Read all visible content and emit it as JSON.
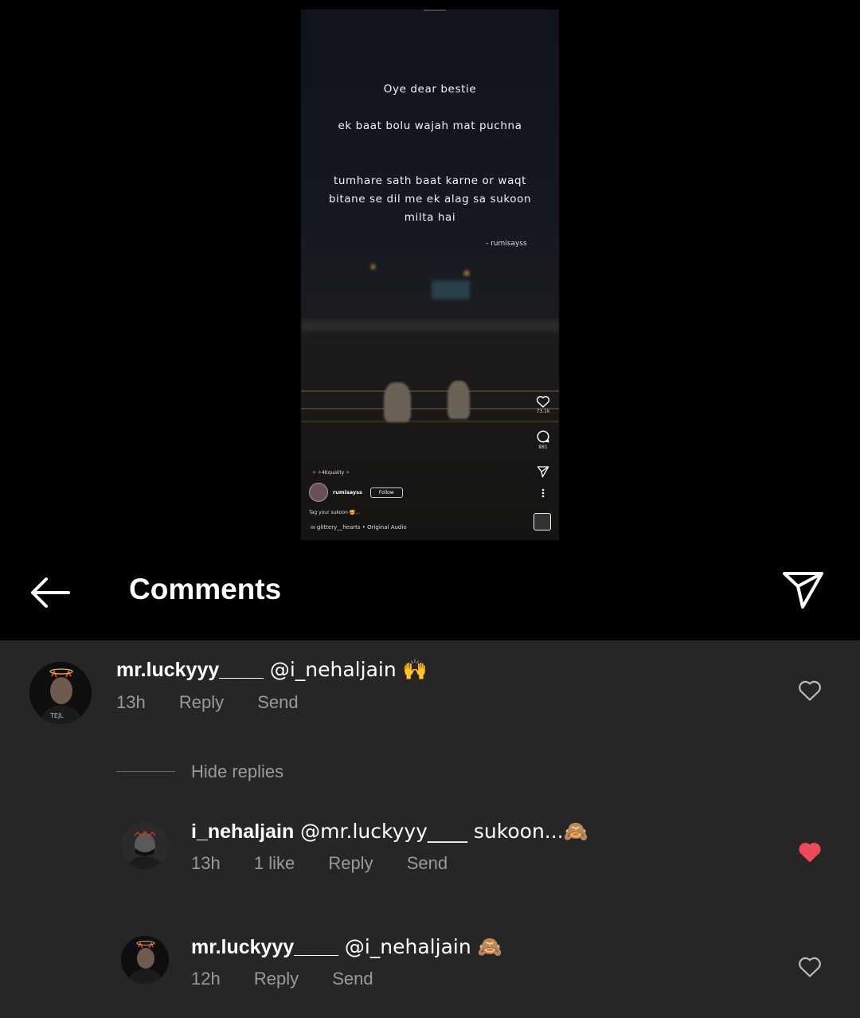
{
  "video": {
    "quote_line1": "Oye dear bestie",
    "quote_line2": "ek baat bolu wajah mat puchna",
    "quote_line3": "tumhare sath baat karne or waqt bitane se dil me ek alag sa sukoon milta hai",
    "credit": "- rumisayss",
    "likes_count": "73.1k",
    "comments_count": "881",
    "quality_tag": "✧ ✧4Kquality ✧",
    "username": "rumisayss",
    "follow_label": "Follow",
    "caption": "Tag your sukoon 🥰...",
    "audio": "ııı glittery__hearts • Original Audio"
  },
  "header": {
    "title": "Comments",
    "back_icon": "arrow-left-icon",
    "share_icon": "send-icon"
  },
  "comments": [
    {
      "username": "mr.luckyyy____",
      "text": " @i_nehaljain 🙌",
      "time": "13h",
      "reply_label": "Reply",
      "send_label": "Send",
      "liked": false
    }
  ],
  "hide_replies_label": "Hide replies",
  "replies": [
    {
      "username": "i_nehaljain",
      "text": " @mr.luckyyy____ sukoon...🙈",
      "time": "13h",
      "likes": "1 like",
      "reply_label": "Reply",
      "send_label": "Send",
      "liked": true
    },
    {
      "username": "mr.luckyyy____",
      "text": " @i_nehaljain 🙈",
      "time": "12h",
      "reply_label": "Reply",
      "send_label": "Send",
      "liked": false
    }
  ],
  "colors": {
    "background": "#000000",
    "list_background": "#262626",
    "meta_text": "#9a9a9a",
    "liked_heart": "#ed4956"
  }
}
